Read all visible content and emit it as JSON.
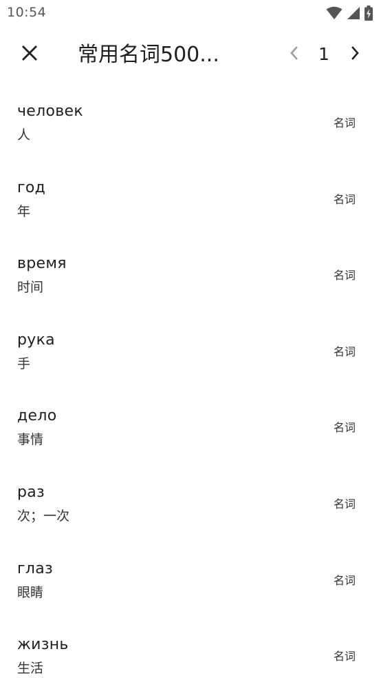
{
  "status_bar": {
    "time": "10:54"
  },
  "header": {
    "title": "常用名词500...",
    "page_number": "1"
  },
  "words": [
    {
      "word": "человек",
      "meaning": "人",
      "pos": "名词"
    },
    {
      "word": "год",
      "meaning": "年",
      "pos": "名词"
    },
    {
      "word": "время",
      "meaning": "时间",
      "pos": "名词"
    },
    {
      "word": "рука",
      "meaning": "手",
      "pos": "名词"
    },
    {
      "word": "дело",
      "meaning": "事情",
      "pos": "名词"
    },
    {
      "word": "раз",
      "meaning": "次；一次",
      "pos": "名词"
    },
    {
      "word": "глаз",
      "meaning": "眼睛",
      "pos": "名词"
    },
    {
      "word": "жизнь",
      "meaning": "生活",
      "pos": "名词"
    }
  ],
  "icons": {
    "close": "close-icon",
    "prev": "chevron-left-icon",
    "next": "chevron-right-icon",
    "wifi": "wifi-icon",
    "signal": "signal-icon",
    "battery": "battery-charging-icon"
  },
  "colors": {
    "text_primary": "#1f1f1f",
    "text_secondary": "#333333",
    "icon_disabled": "#9e9e9e",
    "status_icons": "#555555"
  }
}
